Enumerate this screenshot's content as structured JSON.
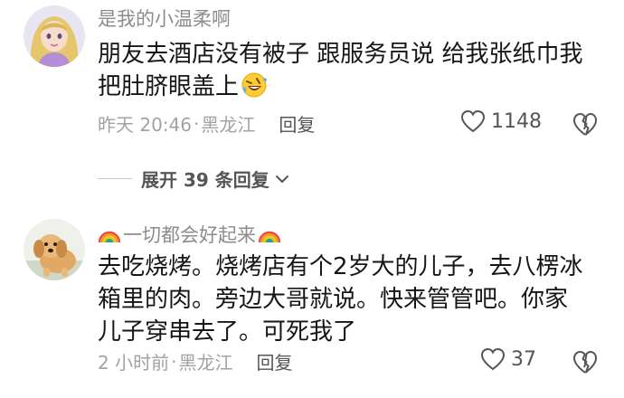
{
  "comments": [
    {
      "username": "是我的小温柔啊",
      "text_line1": "朋友去酒店没有被子 跟服务员说 给我张纸巾我",
      "text_line2": "把肚脐眼盖上",
      "emoji": "rolling-laughing-face-icon",
      "time": "昨天 20:46",
      "location": "黑龙江",
      "reply_label": "回复",
      "likes": "1148"
    },
    {
      "username": "一切都会好起来",
      "username_decoration": "rainbow-icon",
      "text_line1": "去吃烧烤。烧烤店有个2岁大的儿子，去八楞冰",
      "text_line2": "箱里的肉。旁边大哥就说。快来管管吧。你家",
      "text_line3": "儿子穿串去了。可死我了",
      "time": "2 小时前",
      "location": "黑龙江",
      "reply_label": "回复",
      "likes": "37"
    }
  ],
  "expand": {
    "label": "展开 39 条回复"
  },
  "separator": "·",
  "colors": {
    "username": "#8c8c8c",
    "body_text": "#161616",
    "meta": "#a2a2a2",
    "action": "#555555"
  }
}
